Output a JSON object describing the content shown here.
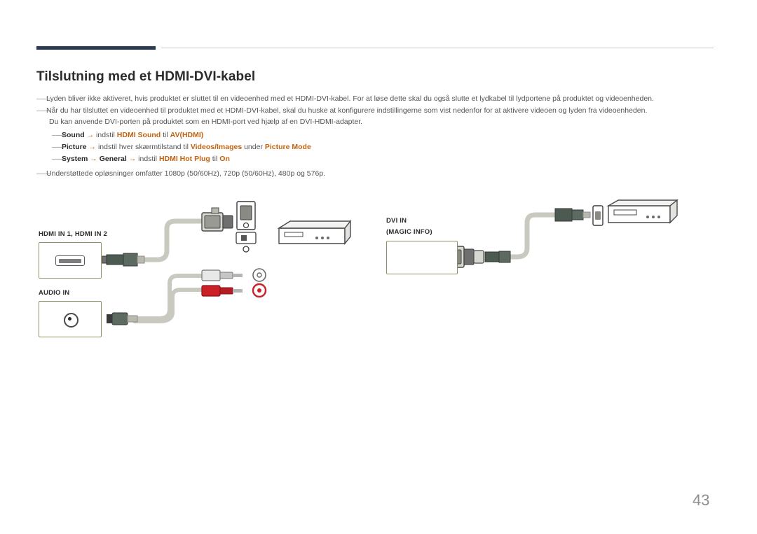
{
  "page": {
    "title": "Tilslutning med et HDMI-DVI-kabel",
    "number": "43"
  },
  "notes": [
    {
      "dash": "――",
      "text": "Lyden bliver ikke aktiveret, hvis produktet er sluttet til en videoenhed med et HDMI-DVI-kabel. For at løse dette skal du også slutte et lydkabel til lydportene på produktet og videoenheden."
    },
    {
      "dash": "――",
      "text": "Når du har tilsluttet en videoenhed til produktet med et HDMI-DVI-kabel, skal du huske at konfigurere indstillingerne som vist nedenfor for at aktivere videoen og lyden fra videoenheden.",
      "continuation": "Du kan anvende DVI-porten på produktet som en HDMI-port ved hjælp af en DVI-HDMI-adapter."
    }
  ],
  "sub_notes": [
    {
      "dash": "――",
      "menu": "Sound",
      "arrow": "→",
      "mid": "indstil",
      "target": "HDMI Sound",
      "til": "til",
      "value": "AV(HDMI)"
    },
    {
      "dash": "――",
      "menu": "Picture",
      "arrow": "→",
      "mid": "indstil hver skærmtilstand til",
      "target": "Videos/Images",
      "til": "under",
      "value": "Picture Mode"
    },
    {
      "dash": "――",
      "menu": "System",
      "arrow": "→",
      "menu2": "General",
      "arrow2": "→",
      "mid": "indstil",
      "target": "HDMI Hot Plug",
      "til": "til",
      "value": "On"
    }
  ],
  "note_last": {
    "dash": "――",
    "text": "Understøttede opløsninger omfatter 1080p (50/60Hz), 720p (50/60Hz), 480p og 576p."
  },
  "diagram": {
    "labels": {
      "hdmi_in": "HDMI IN 1, HDMI IN 2",
      "audio_in": "AUDIO IN",
      "dvi_in": "DVI IN",
      "magic_info": "(MAGIC INFO)"
    },
    "colors": {
      "plate_border": "#8e8f62",
      "cable_gray": "#c9c9c0",
      "connector_dark": "#4d5a52",
      "rca_red": "#cc2027",
      "rca_white": "#e8e8e8",
      "device_outline": "#4a4a4a"
    }
  }
}
